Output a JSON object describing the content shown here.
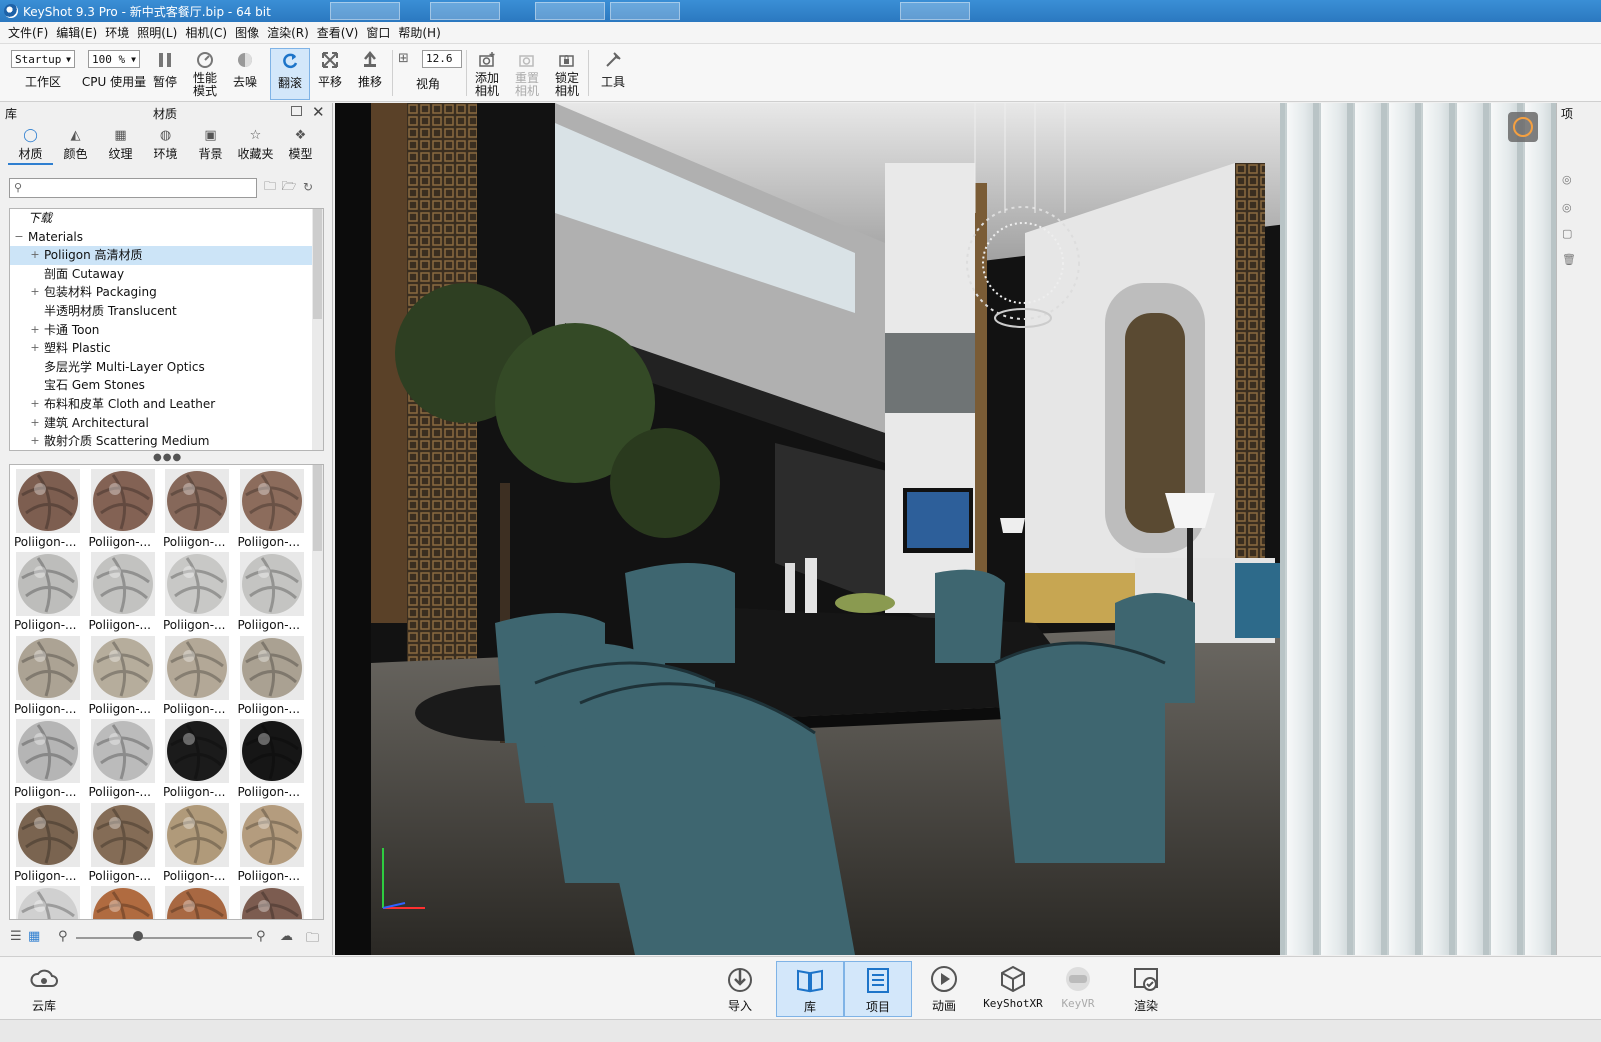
{
  "window": {
    "title": "KeyShot 9.3 Pro  - 新中式客餐厅.bip  - 64 bit"
  },
  "menu": [
    "文件(F)",
    "编辑(E)",
    "环境",
    "照明(L)",
    "相机(C)",
    "图像",
    "渲染(R)",
    "查看(V)",
    "窗口",
    "帮助(H)"
  ],
  "toolbar": {
    "workspace_value": "Startup",
    "workspace_label": "工作区",
    "cpu_value": "100 %",
    "cpu_label": "CPU 使用量",
    "pause_label": "暂停",
    "perf_label": "性能\n模式",
    "denoise_label": "去噪",
    "tumble_label": "翻滚",
    "pan_label": "平移",
    "dolly_label": "推移",
    "fov_value": "12.6",
    "fov_label": "视角",
    "add_camera_label": "添加\n相机",
    "reset_camera_label": "重置\n相机",
    "lock_camera_label": "锁定\n相机",
    "tools_label": "工具"
  },
  "library": {
    "panel_label": "库",
    "title": "材质",
    "tabs": [
      "材质",
      "颜色",
      "纹理",
      "环境",
      "背景",
      "收藏夹",
      "模型"
    ],
    "tree": [
      {
        "label": "下载",
        "indent": 0,
        "expander": ""
      },
      {
        "label": "Materials",
        "indent": 0,
        "expander": "−"
      },
      {
        "label": "Poliigon 高清材质",
        "indent": 1,
        "expander": "+"
      },
      {
        "label": "剖面 Cutaway",
        "indent": 1,
        "expander": ""
      },
      {
        "label": "包装材料 Packaging",
        "indent": 1,
        "expander": "+"
      },
      {
        "label": "半透明材质 Translucent",
        "indent": 1,
        "expander": ""
      },
      {
        "label": "卡通 Toon",
        "indent": 1,
        "expander": "+"
      },
      {
        "label": "塑料 Plastic",
        "indent": 1,
        "expander": "+"
      },
      {
        "label": "多层光学 Multi-Layer Optics",
        "indent": 1,
        "expander": ""
      },
      {
        "label": "宝石 Gem Stones",
        "indent": 1,
        "expander": ""
      },
      {
        "label": "布料和皮革 Cloth and Leather",
        "indent": 1,
        "expander": "+"
      },
      {
        "label": "建筑 Architectural",
        "indent": 1,
        "expander": "+"
      },
      {
        "label": "散射介质 Scattering Medium",
        "indent": 1,
        "expander": "+"
      }
    ],
    "selected_index": 2,
    "thumbnail_caption": "Poliigon-...",
    "thumbnail_colors": [
      "#7d5e50",
      "#836254",
      "#86685a",
      "#8c6c5c",
      "#bdbdbb",
      "#c2c2c0",
      "#c8c8c6",
      "#c4c4c2",
      "#aca394",
      "#b6ad9c",
      "#b3a897",
      "#aaa192",
      "#b5b5b5",
      "#bbbbbb",
      "#1b1b1b",
      "#161616",
      "#7a6450",
      "#846c56",
      "#b09a7a",
      "#b49c7e",
      "#d0d0d0",
      "#b06b40",
      "#a86842",
      "#7c5c50"
    ],
    "zoom_level": 0.35
  },
  "right_panel": {
    "label": "项"
  },
  "bottom": {
    "cloud_label": "云库",
    "buttons": [
      "导入",
      "库",
      "项目",
      "动画",
      "KeyShotXR",
      "KeyVR",
      "渲染"
    ]
  }
}
